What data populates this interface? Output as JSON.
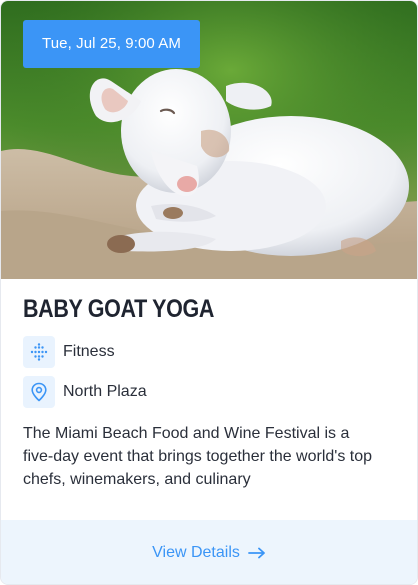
{
  "event": {
    "date_badge": "Tue, Jul 25, 9:00 AM",
    "title": "BABY GOAT YOGA",
    "category": "Fitness",
    "location": "North Plaza",
    "description": "The Miami Beach Food and Wine Festival is a five-day event that brings together the world's top chefs, winemakers, and culinary"
  },
  "actions": {
    "view_details_label": "View Details"
  },
  "icons": {
    "category": "dots-grid-icon",
    "location": "map-pin-icon",
    "cta": "arrow-right-icon"
  },
  "colors": {
    "accent": "#3b95f6",
    "icon_bg": "#e9f3fe",
    "footer_bg": "#edf5fd",
    "title": "#1f2430"
  }
}
